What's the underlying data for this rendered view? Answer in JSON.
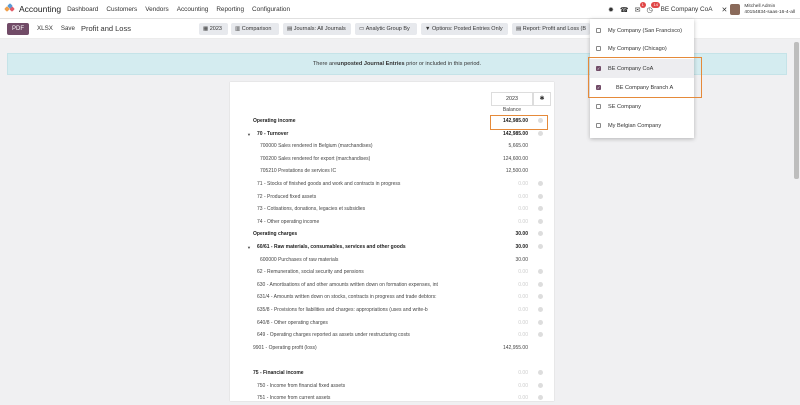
{
  "app": {
    "name": "Accounting"
  },
  "nav": [
    "Dashboard",
    "Customers",
    "Vendors",
    "Accounting",
    "Reporting",
    "Configuration"
  ],
  "topbar": {
    "msg_count": "1",
    "activity_count": "14",
    "company": "BE Company CoA",
    "user_name": "Mitchell Admin",
    "user_db": "40154834-saas-16-4-all"
  },
  "toolbar": {
    "pdf": "PDF",
    "xlsx": "XLSX",
    "save": "Save",
    "title": "Profit and Loss"
  },
  "filters": [
    "2023",
    "Comparison",
    "Journals: All Journals",
    "Analytic Group By",
    "Options: Posted Entries Only",
    "Report: Profit and Loss (B"
  ],
  "banner": {
    "pre": "There are ",
    "strong": "unposted Journal Entries",
    "post": " prior or included in this period."
  },
  "report": {
    "col_header": "2023",
    "sub_header": "Balance",
    "rows": [
      {
        "label": "Operating income",
        "value": "142,985.00",
        "kind": "section"
      },
      {
        "label": "70 - Turnover",
        "value": "142,985.00",
        "kind": "group"
      },
      {
        "label": "700000 Sales rendered in Belgium (marchandises)",
        "value": "5,665.00",
        "kind": "account"
      },
      {
        "label": "700200 Sales rendered for export (marchandises)",
        "value": "124,600.00",
        "kind": "account"
      },
      {
        "label": "705210 Prestations de services IC",
        "value": "12,500.00",
        "kind": "account"
      },
      {
        "label": "71 - Stocks of finished goods and work and contracts in progress",
        "value": "0.00",
        "kind": "line"
      },
      {
        "label": "72 - Produced fixed assets",
        "value": "0.00",
        "kind": "line"
      },
      {
        "label": "73 - Cotisations, donations, legacies et subsidies",
        "value": "0.00",
        "kind": "line"
      },
      {
        "label": "74 - Other operating income",
        "value": "0.00",
        "kind": "line"
      },
      {
        "label": "Operating charges",
        "value": "30.00",
        "kind": "section"
      },
      {
        "label": "60/61 - Raw materials, consumables, services and other goods",
        "value": "30.00",
        "kind": "group"
      },
      {
        "label": "600000 Purchases of raw materials",
        "value": "30.00",
        "kind": "account"
      },
      {
        "label": "62 - Remuneration, social security and pensions",
        "value": "0.00",
        "kind": "line"
      },
      {
        "label": "630 - Amortisations of and other amounts written down on formation expenses, int",
        "value": "0.00",
        "kind": "line"
      },
      {
        "label": "631/4 - Amounts written down on stocks, contracts in progress and trade debtors:",
        "value": "0.00",
        "kind": "line"
      },
      {
        "label": "635/8 - Provisions for liabilities and charges: appropriations (uses and write-b",
        "value": "0.00",
        "kind": "line"
      },
      {
        "label": "640/8 - Other operating charges",
        "value": "0.00",
        "kind": "line"
      },
      {
        "label": "649 - Operating charges reported as assets under restructuring costs",
        "value": "0.00",
        "kind": "line"
      },
      {
        "label": "9901 - Operating profit (loss)",
        "value": "142,955.00",
        "kind": "total"
      },
      {
        "label": "",
        "value": "",
        "kind": "blank"
      },
      {
        "label": "75 - Financial income",
        "value": "0.00",
        "kind": "section-muted"
      },
      {
        "label": "750 - Income from financial fixed assets",
        "value": "0.00",
        "kind": "line"
      },
      {
        "label": "751 - Income from current assets",
        "value": "0.00",
        "kind": "line"
      }
    ]
  },
  "company_dropdown": [
    {
      "label": "My Company (San Francisco)",
      "checked": false
    },
    {
      "label": "My Company (Chicago)",
      "checked": false
    },
    {
      "label": "BE Company CoA",
      "checked": true
    },
    {
      "label": "BE Company Branch A",
      "checked": true
    },
    {
      "label": "SE Company",
      "checked": false
    },
    {
      "label": "My Belgian Company",
      "checked": false
    }
  ],
  "colors": {
    "primary": "#714b67",
    "highlight": "#e58a3a",
    "banner_bg": "#d4ecf0"
  }
}
